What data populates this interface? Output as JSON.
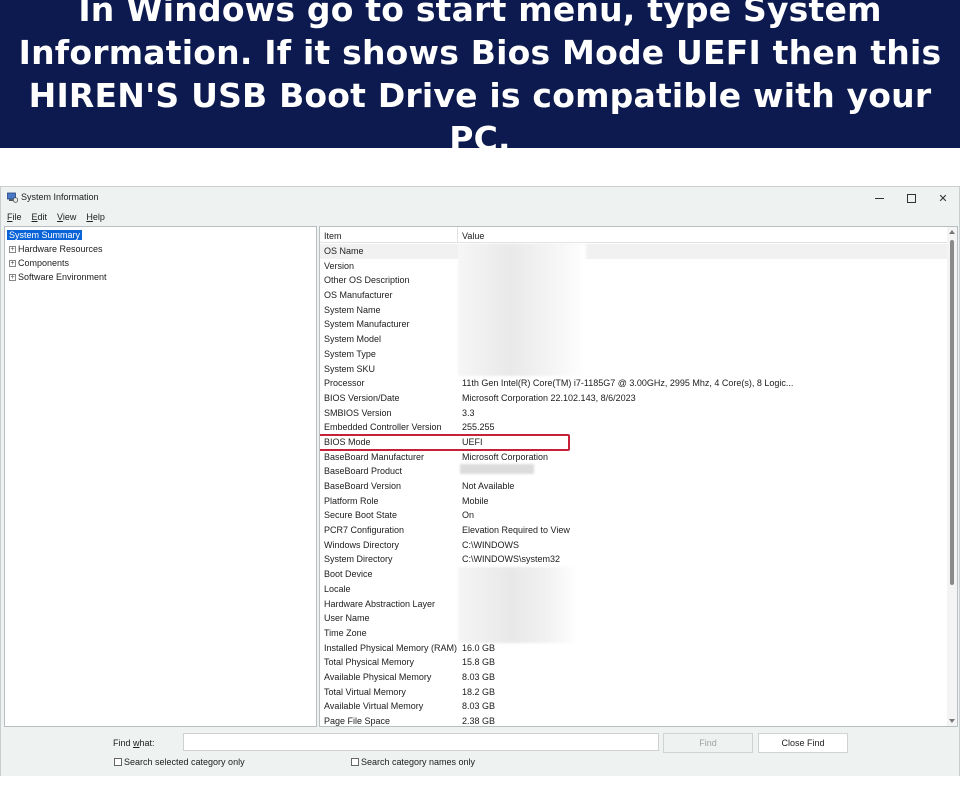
{
  "banner": {
    "line1": "In Windows go to start menu, type System",
    "line2": "Information. If it shows Bios Mode UEFI then this",
    "line3": "HIREN'S USB Boot Drive is compatible with your PC."
  },
  "window": {
    "title": "System Information",
    "menu": [
      {
        "key": "F",
        "rest": "ile"
      },
      {
        "key": "E",
        "rest": "dit"
      },
      {
        "key": "V",
        "rest": "iew"
      },
      {
        "key": "H",
        "rest": "elp"
      }
    ]
  },
  "tree": {
    "items": [
      {
        "label": "System Summary",
        "selected": true
      },
      {
        "label": "Hardware Resources",
        "expander": "+"
      },
      {
        "label": "Components",
        "expander": "+"
      },
      {
        "label": "Software Environment",
        "expander": "+"
      }
    ]
  },
  "table": {
    "header_item": "Item",
    "header_value": "Value",
    "rows": [
      {
        "item": "OS Name",
        "value": ""
      },
      {
        "item": "Version",
        "value": ""
      },
      {
        "item": "Other OS Description",
        "value": ""
      },
      {
        "item": "OS Manufacturer",
        "value": ""
      },
      {
        "item": "System Name",
        "value": ""
      },
      {
        "item": "System Manufacturer",
        "value": ""
      },
      {
        "item": "System Model",
        "value": ""
      },
      {
        "item": "System Type",
        "value": ""
      },
      {
        "item": "System SKU",
        "value": ""
      },
      {
        "item": "Processor",
        "value": "11th Gen Intel(R) Core(TM) i7-1185G7 @ 3.00GHz, 2995 Mhz, 4 Core(s), 8 Logic..."
      },
      {
        "item": "BIOS Version/Date",
        "value": "Microsoft Corporation 22.102.143, 8/6/2023"
      },
      {
        "item": "SMBIOS Version",
        "value": "3.3"
      },
      {
        "item": "Embedded Controller Version",
        "value": "255.255"
      },
      {
        "item": "BIOS Mode",
        "value": "UEFI"
      },
      {
        "item": "BaseBoard Manufacturer",
        "value": "Microsoft Corporation"
      },
      {
        "item": "BaseBoard Product",
        "value": ""
      },
      {
        "item": "BaseBoard Version",
        "value": "Not Available"
      },
      {
        "item": "Platform Role",
        "value": "Mobile"
      },
      {
        "item": "Secure Boot State",
        "value": "On"
      },
      {
        "item": "PCR7 Configuration",
        "value": "Elevation Required to View"
      },
      {
        "item": "Windows Directory",
        "value": "C:\\WINDOWS"
      },
      {
        "item": "System Directory",
        "value": "C:\\WINDOWS\\system32"
      },
      {
        "item": "Boot Device",
        "value": ""
      },
      {
        "item": "Locale",
        "value": ""
      },
      {
        "item": "Hardware Abstraction Layer",
        "value": ""
      },
      {
        "item": "User Name",
        "value": ""
      },
      {
        "item": "Time Zone",
        "value": ""
      },
      {
        "item": "Installed Physical Memory (RAM)",
        "value": "16.0 GB"
      },
      {
        "item": "Total Physical Memory",
        "value": "15.8 GB"
      },
      {
        "item": "Available Physical Memory",
        "value": "8.03 GB"
      },
      {
        "item": "Total Virtual Memory",
        "value": "18.2 GB"
      },
      {
        "item": "Available Virtual Memory",
        "value": "8.03 GB"
      },
      {
        "item": "Page File Space",
        "value": "2.38 GB"
      }
    ]
  },
  "find": {
    "label_key": "w",
    "label_before": "Find ",
    "label_after": "hat:",
    "input_value": "",
    "find_button": "Find",
    "close_find_button": "Close Find",
    "check_selected": "Search selected category only",
    "check_names": "Search category names only"
  },
  "colors": {
    "banner_bg": "#0c1a4f",
    "selection": "#0a64d8",
    "highlight_box": "#c9203a"
  }
}
